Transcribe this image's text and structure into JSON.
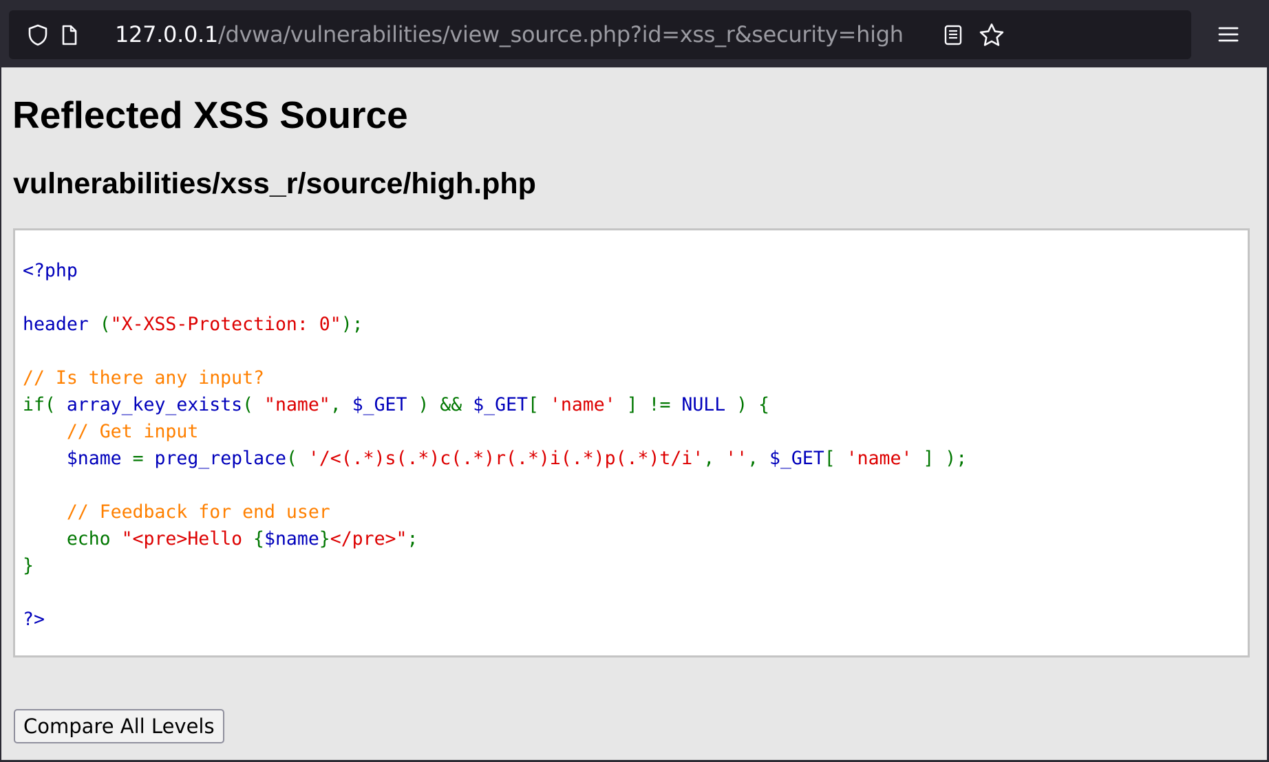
{
  "browser": {
    "url_host": "127.0.0.1",
    "url_path": "/dvwa/vulnerabilities/view_source.php?id=xss_r&security=high",
    "icons": [
      "shield-icon",
      "page-icon",
      "reader-view-icon",
      "bookmark-star-icon",
      "menu-icon"
    ]
  },
  "page": {
    "title": "Reflected XSS Source",
    "file_path": "vulnerabilities/xss_r/source/high.php",
    "compare_button": "Compare All Levels"
  },
  "code_lines": [
    [
      {
        "t": "fn",
        "s": "<?php"
      }
    ],
    [],
    [
      {
        "t": "fn",
        "s": "header"
      },
      {
        "t": "kw",
        "s": " ("
      },
      {
        "t": "str",
        "s": "\"X-XSS-Protection: 0\""
      },
      {
        "t": "kw",
        "s": ");"
      }
    ],
    [],
    [
      {
        "t": "cm",
        "s": "// Is there any input?"
      }
    ],
    [
      {
        "t": "kw",
        "s": "if( "
      },
      {
        "t": "fn",
        "s": "array_key_exists"
      },
      {
        "t": "kw",
        "s": "( "
      },
      {
        "t": "str",
        "s": "\"name\""
      },
      {
        "t": "kw",
        "s": ", "
      },
      {
        "t": "fn",
        "s": "$_GET"
      },
      {
        "t": "kw",
        "s": " ) && "
      },
      {
        "t": "fn",
        "s": "$_GET"
      },
      {
        "t": "kw",
        "s": "[ "
      },
      {
        "t": "str",
        "s": "'name'"
      },
      {
        "t": "kw",
        "s": " ] != "
      },
      {
        "t": "fn",
        "s": "NULL"
      },
      {
        "t": "kw",
        "s": " ) {"
      }
    ],
    [
      {
        "t": "kw",
        "s": "    "
      },
      {
        "t": "cm",
        "s": "// Get input"
      }
    ],
    [
      {
        "t": "kw",
        "s": "    "
      },
      {
        "t": "fn",
        "s": "$name"
      },
      {
        "t": "kw",
        "s": " = "
      },
      {
        "t": "fn",
        "s": "preg_replace"
      },
      {
        "t": "kw",
        "s": "( "
      },
      {
        "t": "str",
        "s": "'/<(.*)s(.*)c(.*)r(.*)i(.*)p(.*)t/i'"
      },
      {
        "t": "kw",
        "s": ", "
      },
      {
        "t": "str",
        "s": "''"
      },
      {
        "t": "kw",
        "s": ", "
      },
      {
        "t": "fn",
        "s": "$_GET"
      },
      {
        "t": "kw",
        "s": "[ "
      },
      {
        "t": "str",
        "s": "'name'"
      },
      {
        "t": "kw",
        "s": " ] );"
      }
    ],
    [],
    [
      {
        "t": "kw",
        "s": "    "
      },
      {
        "t": "cm",
        "s": "// Feedback for end user"
      }
    ],
    [
      {
        "t": "kw",
        "s": "    echo "
      },
      {
        "t": "str",
        "s": "\"<pre>Hello "
      },
      {
        "t": "kw",
        "s": "{"
      },
      {
        "t": "fn",
        "s": "$name"
      },
      {
        "t": "kw",
        "s": "}"
      },
      {
        "t": "str",
        "s": "</pre>\""
      },
      {
        "t": "kw",
        "s": ";"
      }
    ],
    [
      {
        "t": "kw",
        "s": "}"
      }
    ],
    [],
    [
      {
        "t": "fn",
        "s": "?>"
      }
    ]
  ],
  "colors": {
    "keyword": "#007700",
    "function": "#0000bb",
    "string": "#dd0000",
    "comment": "#ff8000",
    "page_background": "#e7e7e7",
    "chrome_background": "#2b2a33"
  }
}
